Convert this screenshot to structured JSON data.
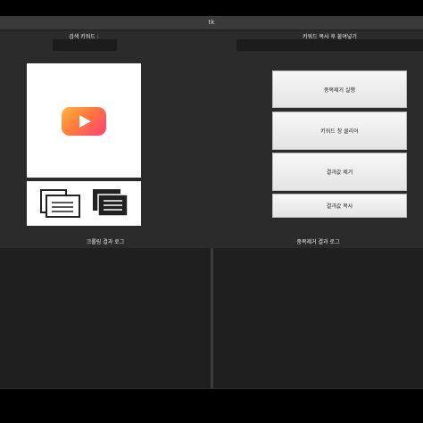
{
  "window": {
    "title": "tk"
  },
  "search": {
    "label": "검색 키워드 :",
    "value": ""
  },
  "paste": {
    "label": "키워드 복사 후 붙여넣기",
    "value": ""
  },
  "buttons": {
    "dedupe": "중복제거 실행",
    "clear": "키워드 창 클리어",
    "remove_result": "결과값 제거",
    "copy_result": "결과값 복사"
  },
  "logs": {
    "crawl_title": "크롤링 결과 로그",
    "dedupe_title": "중복제거 결과 로그"
  },
  "icons": {
    "thumbnail": "youtube-play-icon",
    "copy_outline": "copy-document-outline-icon",
    "copy_filled": "copy-document-filled-icon"
  },
  "colors": {
    "window_bg": "#2b2b2b",
    "log_bg": "#1f1f1f",
    "play_gradient_start": "#ffb53c",
    "play_gradient_end": "#ff3f7a"
  }
}
